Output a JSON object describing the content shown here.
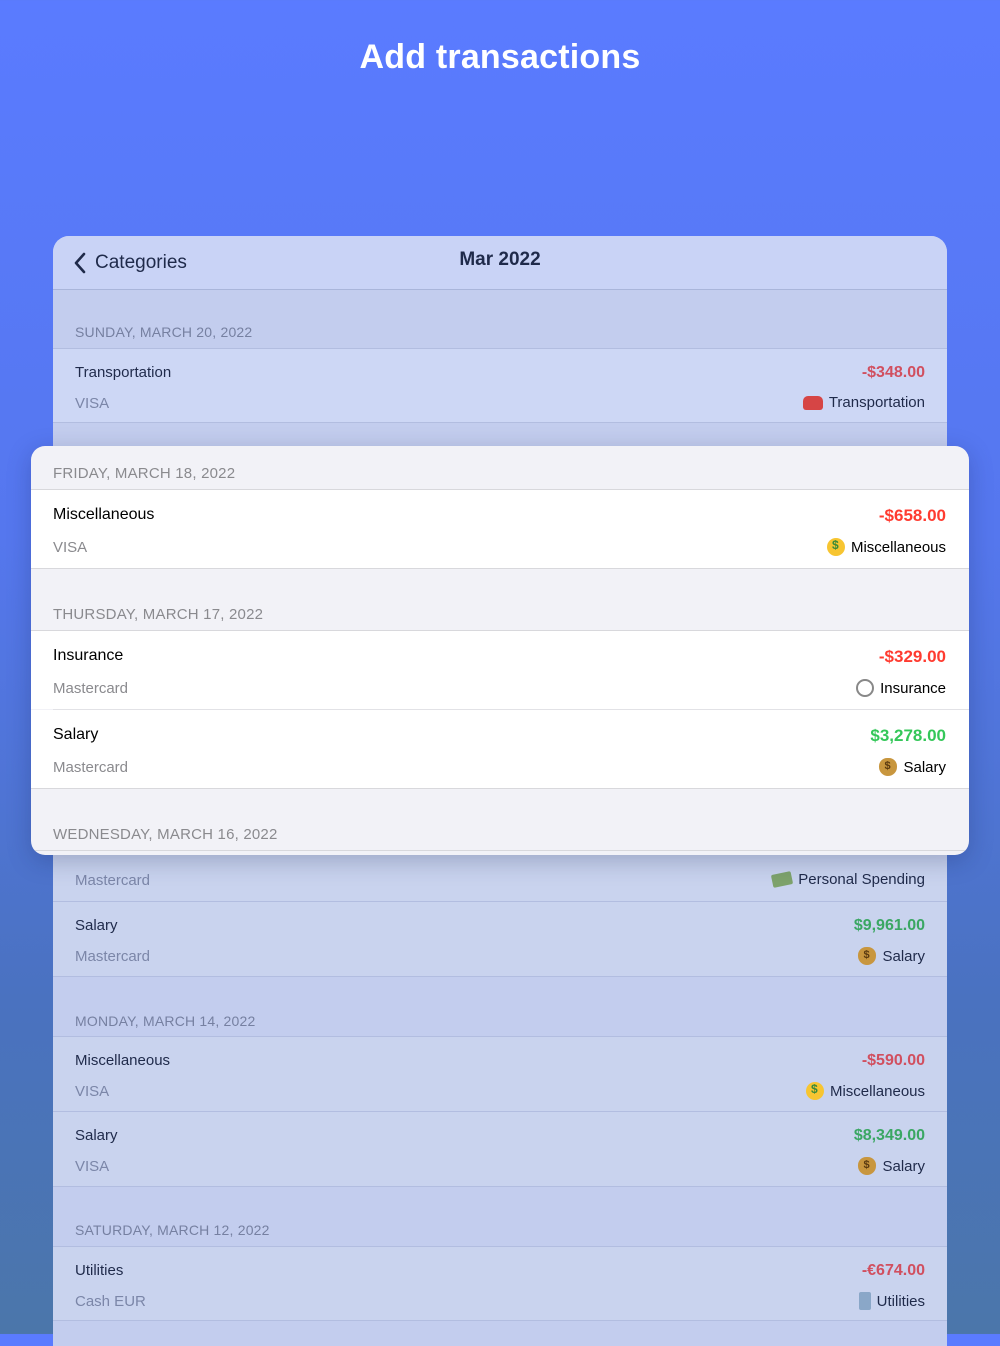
{
  "headline": "Add transactions",
  "nav": {
    "back_label": "Categories",
    "title": "Mar 2022"
  },
  "background_list": {
    "sections": [
      {
        "header": "SUNDAY, MARCH 20, 2022",
        "rows": [
          {
            "title": "Transportation",
            "account": "VISA",
            "amount": "-$348.00",
            "category": "Transportation",
            "icon": "car-icon"
          }
        ]
      },
      {
        "header": "",
        "rows": [
          {
            "title": "",
            "account": "Mastercard",
            "amount": "",
            "category": "Personal Spending",
            "icon": "cash-icon"
          },
          {
            "title": "Salary",
            "account": "Mastercard",
            "amount": "$9,961.00",
            "category": "Salary",
            "icon": "money-bag-icon"
          }
        ]
      },
      {
        "header": "MONDAY, MARCH 14, 2022",
        "rows": [
          {
            "title": "Miscellaneous",
            "account": "VISA",
            "amount": "-$590.00",
            "category": "Miscellaneous",
            "icon": "money-face-icon"
          },
          {
            "title": "Salary",
            "account": "VISA",
            "amount": "$8,349.00",
            "category": "Salary",
            "icon": "money-bag-icon"
          }
        ]
      },
      {
        "header": "SATURDAY, MARCH 12, 2022",
        "rows": [
          {
            "title": "Utilities",
            "account": "Cash EUR",
            "amount": "-€674.00",
            "category": "Utilities",
            "icon": "tap-icon"
          }
        ]
      }
    ]
  },
  "card": {
    "sections": [
      {
        "header": "FRIDAY, MARCH 18, 2022",
        "rows": [
          {
            "title": "Miscellaneous",
            "account": "VISA",
            "amount": "-$658.00",
            "category": "Miscellaneous",
            "icon": "money-face-icon"
          }
        ]
      },
      {
        "header": "THURSDAY, MARCH 17, 2022",
        "rows": [
          {
            "title": "Insurance",
            "account": "Mastercard",
            "amount": "-$329.00",
            "category": "Insurance",
            "icon": "stethoscope-icon"
          },
          {
            "title": "Salary",
            "account": "Mastercard",
            "amount": "$3,278.00",
            "category": "Salary",
            "icon": "money-bag-icon"
          }
        ]
      },
      {
        "header": "WEDNESDAY, MARCH 16, 2022",
        "rows": []
      }
    ]
  },
  "colors": {
    "expense": "#ff3b30",
    "income": "#34c759",
    "background_top": "#5a7bff"
  }
}
